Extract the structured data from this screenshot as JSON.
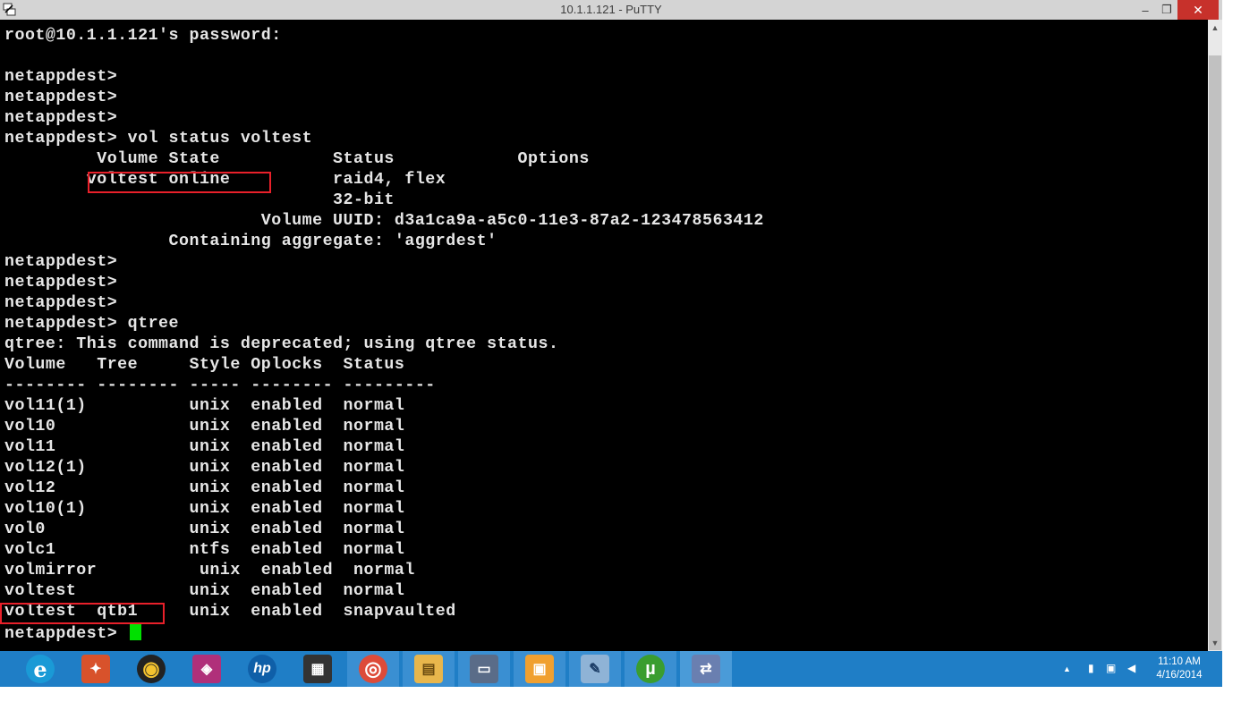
{
  "window": {
    "title": "10.1.1.121 - PuTTY",
    "controls": {
      "minimize": "‒",
      "maximize": "❐",
      "close": "✕"
    }
  },
  "terminal": {
    "lines": [
      "root@10.1.1.121's password:",
      "",
      "netappdest>",
      "netappdest>",
      "netappdest>",
      "netappdest> vol status voltest",
      "         Volume State           Status            Options",
      "        voltest online          raid4, flex",
      "                                32-bit",
      "                         Volume UUID: d3a1ca9a-a5c0-11e3-87a2-123478563412",
      "                Containing aggregate: 'aggrdest'",
      "netappdest>",
      "netappdest>",
      "netappdest>",
      "netappdest> qtree",
      "qtree: This command is deprecated; using qtree status.",
      "Volume   Tree     Style Oplocks  Status",
      "-------- -------- ----- -------- ---------",
      "vol11(1)          unix  enabled  normal",
      "vol10             unix  enabled  normal",
      "vol11             unix  enabled  normal",
      "vol12(1)          unix  enabled  normal",
      "vol12             unix  enabled  normal",
      "vol10(1)          unix  enabled  normal",
      "vol0              unix  enabled  normal",
      "volc1             ntfs  enabled  normal",
      "volmirror          unix  enabled  normal",
      "voltest           unix  enabled  normal",
      "voltest  qtb1     unix  enabled  snapvaulted",
      "netappdest>"
    ],
    "cursor_color": "#00e000",
    "highlight_color": "#e8202a"
  },
  "taskbar": {
    "apps": [
      {
        "name": "internet-explorer",
        "glyph": "e",
        "color": "#1a9ad6",
        "state": "normal"
      },
      {
        "name": "photo-gallery",
        "glyph": "✦",
        "color": "#d8522b",
        "state": "normal"
      },
      {
        "name": "media-player",
        "glyph": "◉",
        "color": "#222222",
        "state": "normal"
      },
      {
        "name": "wireless-tool",
        "glyph": "◈",
        "color": "#b0307a",
        "state": "normal"
      },
      {
        "name": "hp-support",
        "glyph": "hp",
        "color": "#0f5fa8",
        "state": "normal"
      },
      {
        "name": "tools-app",
        "glyph": "▦",
        "color": "#333333",
        "state": "normal"
      },
      {
        "name": "chrome",
        "glyph": "◎",
        "color": "#dd4b39",
        "state": "running"
      },
      {
        "name": "file-explorer",
        "glyph": "▤",
        "color": "#e8b64c",
        "state": "running"
      },
      {
        "name": "remote-desktop",
        "glyph": "▭",
        "color": "#5a6c88",
        "state": "running"
      },
      {
        "name": "virtual-box",
        "glyph": "▣",
        "color": "#f0a030",
        "state": "running"
      },
      {
        "name": "paint",
        "glyph": "✎",
        "color": "#8fb3d6",
        "state": "running"
      },
      {
        "name": "utorrent",
        "glyph": "µ",
        "color": "#3a9d2f",
        "state": "running"
      },
      {
        "name": "putty",
        "glyph": "⇄",
        "color": "#6a7fb0",
        "state": "active"
      }
    ],
    "tray": {
      "expand": "▲",
      "battery": "▮",
      "network": "▣",
      "volume": "◀"
    },
    "clock": {
      "time": "11:10 AM",
      "date": "4/16/2014"
    }
  }
}
